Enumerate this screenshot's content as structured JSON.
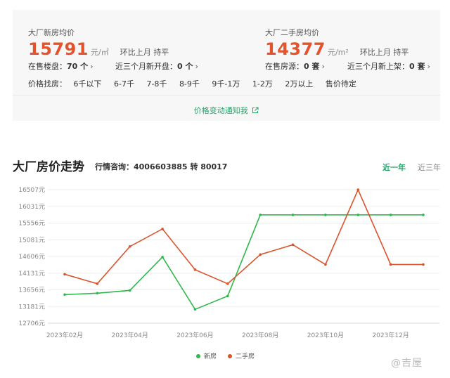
{
  "new_home": {
    "title": "大厂新房均价",
    "price": "15791",
    "unit": "元/㎡",
    "mom": "环比上月 持平",
    "on_sale_label": "在售楼盘：",
    "on_sale_value": "70 个",
    "recent_label": "近三个月新开盘：",
    "recent_value": "0 个"
  },
  "second_hand": {
    "title": "大厂二手房均价",
    "price": "14377",
    "unit": "元/m²",
    "mom": "环比上月 持平",
    "on_sale_label": "在售房源：",
    "on_sale_value": "0 套",
    "recent_label": "近三个月新上架：",
    "recent_value": "0 套"
  },
  "filter": {
    "label": "价格找房：",
    "options": [
      "6千以下",
      "6-7千",
      "7-8千",
      "8-9千",
      "9千-1万",
      "1-2万",
      "2万以上",
      "售价待定"
    ]
  },
  "notify_link": "价格变动通知我",
  "trend": {
    "title": "大厂房价走势",
    "consult": "行情咨询：4006603885 转 80017",
    "tabs": [
      "近一年",
      "近三年"
    ]
  },
  "watermark": "@吉屋",
  "colors": {
    "new": "#2eb84b",
    "second": "#d9542b",
    "accent": "#2aa36a",
    "price": "#e4532b"
  },
  "chart_data": {
    "type": "line",
    "y_ticks": [
      "12706元",
      "13181元",
      "13656元",
      "14131元",
      "14606元",
      "15081元",
      "15556元",
      "16031元",
      "16507元"
    ],
    "ylim": [
      12706,
      16507
    ],
    "x_ticks": [
      "2023年02月",
      "2023年04月",
      "2023年06月",
      "2023年08月",
      "2023年10月",
      "2023年12月"
    ],
    "x": [
      "2023-02",
      "2023-03",
      "2023-04",
      "2023-05",
      "2023-06",
      "2023-07",
      "2023-08",
      "2023-09",
      "2023-10",
      "2023-11",
      "2023-12",
      "2024-01"
    ],
    "series": [
      {
        "name": "新房",
        "color": "#2eb84b",
        "values": [
          13520,
          13560,
          13640,
          14590,
          13100,
          13480,
          15791,
          15791,
          15791,
          15791,
          15791,
          15791
        ]
      },
      {
        "name": "二手房",
        "color": "#d9542b",
        "values": [
          14100,
          13830,
          14890,
          15390,
          14230,
          13830,
          14660,
          14940,
          14377,
          16507,
          14377,
          14377
        ]
      }
    ],
    "grid": true,
    "legend": "bottom"
  }
}
